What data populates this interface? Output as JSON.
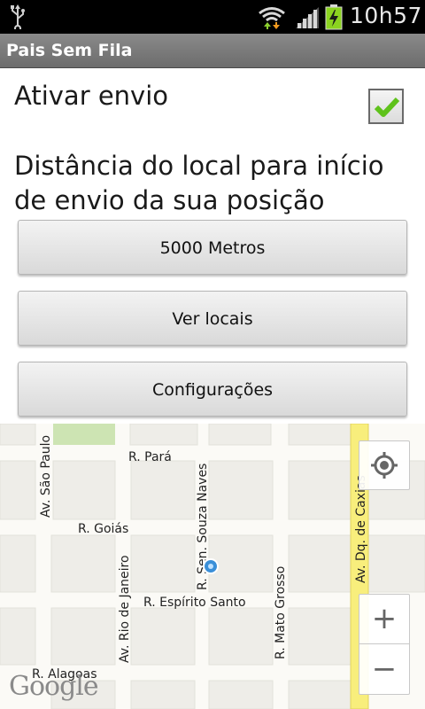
{
  "status_bar": {
    "time": "10h57"
  },
  "app": {
    "title": "Pais Sem Fila"
  },
  "settings": {
    "enable_label": "Ativar envio",
    "enable_checked": true,
    "distance_label_line1": "Distância do local para início",
    "distance_label_line2": "de envio da sua posição"
  },
  "buttons": {
    "distance": "5000 Metros",
    "locations": "Ver locais",
    "settings": "Configurações"
  },
  "map": {
    "streets": {
      "para": "R. Pará",
      "goias": "R. Goiás",
      "espirito_santo": "R. Espírito Santo",
      "alagoas": "R. Alagoas",
      "sao_paulo": "Av. São Paulo",
      "rio_de_janeiro": "Av. Rio de Janeiro",
      "souza_naves": "R. Sen. Souza Naves",
      "mato_grosso": "R. Mato Grosso",
      "duque_caxias": "Av. Dq. de Caxias"
    },
    "zoom_in": "+",
    "zoom_out": "−",
    "logo": "Google",
    "colors": {
      "highlight_road": "#f8ee7c",
      "park": "#cde4b3",
      "block": "#eeede8"
    }
  }
}
